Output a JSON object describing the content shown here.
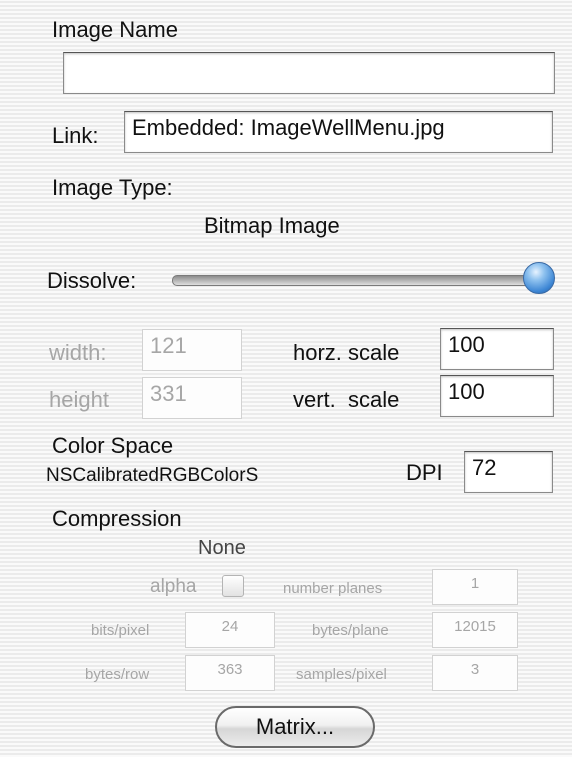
{
  "image_name": {
    "label": "Image Name",
    "value": ""
  },
  "link": {
    "label": "Link:",
    "value": "Embedded: ImageWellMenu.jpg"
  },
  "image_type": {
    "label": "Image Type:",
    "value": "Bitmap Image"
  },
  "dissolve": {
    "label": "Dissolve:",
    "level_percent": 100
  },
  "size": {
    "width_label": "width:",
    "width_value": "121",
    "height_label": "height",
    "height_value": "331",
    "horz_scale_label": "horz. scale",
    "horz_scale_value": "100",
    "vert_scale_label": "vert.  scale",
    "vert_scale_value": "100"
  },
  "color_space": {
    "label": "Color Space",
    "value": "NSCalibratedRGBColorS"
  },
  "dpi": {
    "label": "DPI",
    "value": "72"
  },
  "compression": {
    "label": "Compression",
    "value": "None"
  },
  "bitmap": {
    "alpha_label": "alpha",
    "alpha_checked": false,
    "number_planes_label": "number planes",
    "number_planes_value": "1",
    "bits_per_pixel_label": "bits/pixel",
    "bits_per_pixel_value": "24",
    "bytes_per_plane_label": "bytes/plane",
    "bytes_per_plane_value": "12015",
    "bytes_per_row_label": "bytes/row",
    "bytes_per_row_value": "363",
    "samples_per_pixel_label": "samples/pixel",
    "samples_per_pixel_value": "3"
  },
  "matrix_button": {
    "label": "Matrix..."
  },
  "colors": {
    "slider_knob": "#3d86d4"
  }
}
